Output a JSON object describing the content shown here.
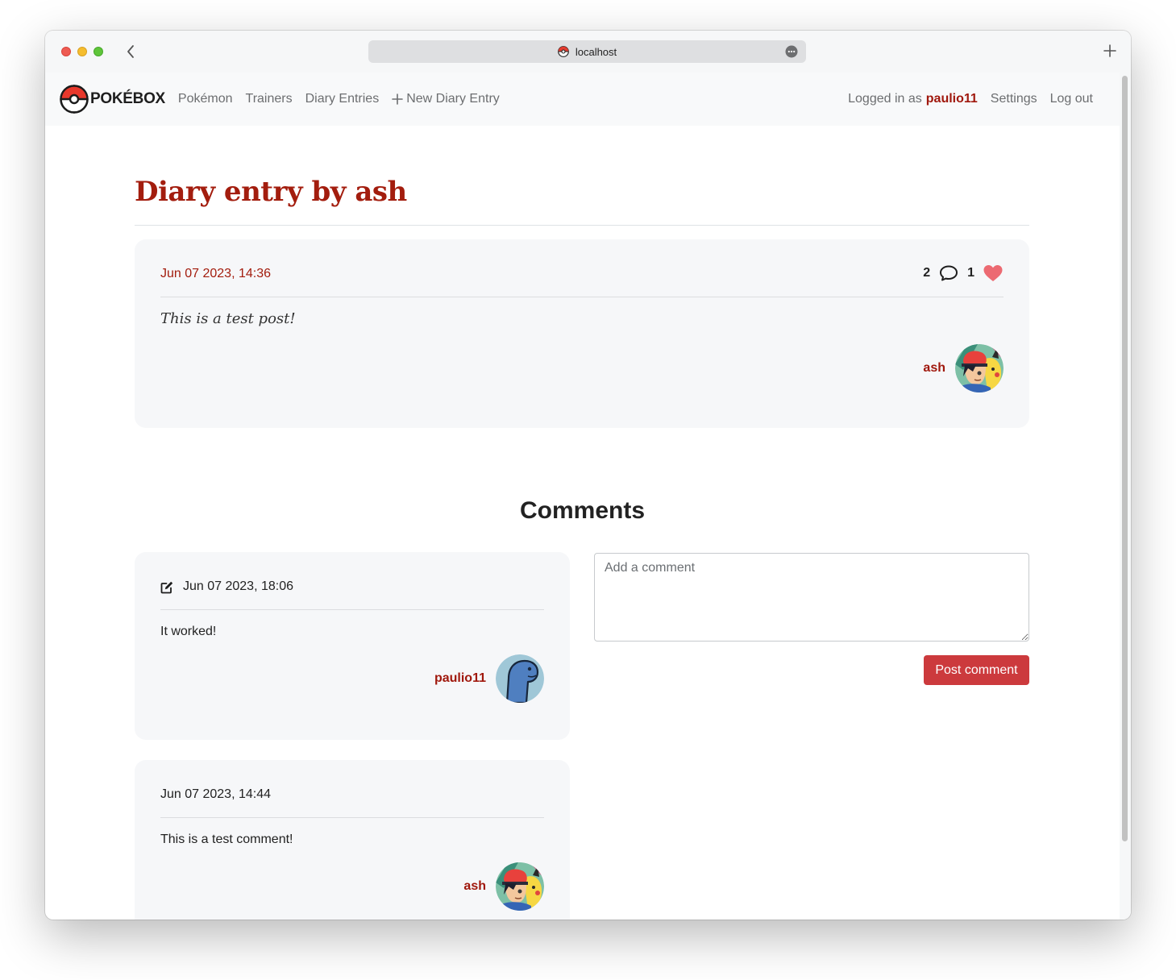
{
  "browser": {
    "url": "localhost"
  },
  "navbar": {
    "brand": "POKÉBOX",
    "links": [
      {
        "label": "Pokémon"
      },
      {
        "label": "Trainers"
      },
      {
        "label": "Diary Entries"
      },
      {
        "label": "New Diary Entry",
        "icon": "plus-icon"
      }
    ],
    "logged_in_prefix": "Logged in as",
    "logged_in_user": "paulio11",
    "settings": "Settings",
    "logout": "Log out"
  },
  "page": {
    "title": "Diary entry by ash"
  },
  "entry": {
    "date": "Jun 07 2023, 14:36",
    "comment_count": "2",
    "like_count": "1",
    "body": "This is a test post!",
    "author": "ash",
    "icons": [
      "comment-bubble-icon",
      "heart-icon"
    ]
  },
  "comments": {
    "heading": "Comments",
    "items": [
      {
        "date": "Jun 07 2023, 18:06",
        "body": "It worked!",
        "author": "paulio11",
        "editable": true,
        "icon": "edit-icon"
      },
      {
        "date": "Jun 07 2023, 14:44",
        "body": "This is a test comment!",
        "author": "ash",
        "editable": false
      }
    ],
    "form": {
      "placeholder": "Add a comment",
      "value": "",
      "submit_label": "Post comment"
    }
  },
  "colors": {
    "accent": "#a31d0e",
    "button": "#cc3a3d",
    "card_bg": "#f6f7f9",
    "heart": "#ec6a72"
  }
}
